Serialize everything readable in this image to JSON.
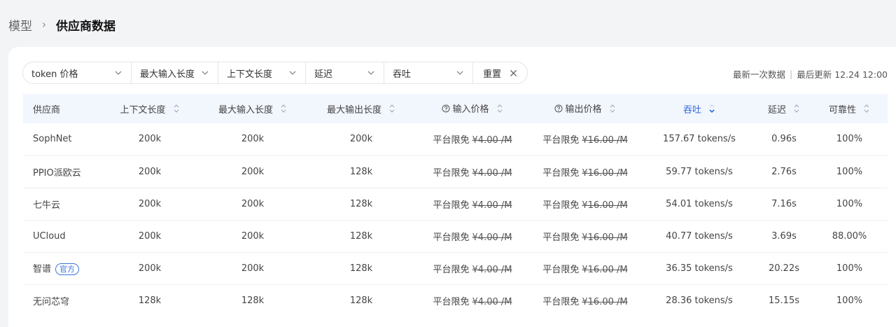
{
  "breadcrumb": {
    "parent": "模型",
    "current": "供应商数据"
  },
  "filters": [
    {
      "label": "token 价格"
    },
    {
      "label": "最大输入长度"
    },
    {
      "label": "上下文长度"
    },
    {
      "label": "延迟"
    },
    {
      "label": "吞吐"
    }
  ],
  "reset_label": "重置",
  "updated": {
    "latest": "最新一次数据",
    "last_update": "最后更新 12.24 12:00"
  },
  "columns": [
    "供应商",
    "上下文长度",
    "最大输入长度",
    "最大输出长度",
    "输入价格",
    "输出价格",
    "吞吐",
    "延迟",
    "可靠性"
  ],
  "free_label": "平台限免",
  "rows": [
    {
      "provider": "SophNet",
      "badge": "",
      "context": "200k",
      "max_in": "200k",
      "max_out": "200k",
      "in_price": "¥4.00 /M",
      "out_price": "¥16.00 /M",
      "throughput": "157.67 tokens/s",
      "latency": "0.96s",
      "reliability": "100%"
    },
    {
      "provider": "PPIO派欧云",
      "badge": "",
      "context": "200k",
      "max_in": "200k",
      "max_out": "128k",
      "in_price": "¥4.00 /M",
      "out_price": "¥16.00 /M",
      "throughput": "59.77 tokens/s",
      "latency": "2.76s",
      "reliability": "100%"
    },
    {
      "provider": "七牛云",
      "badge": "",
      "context": "200k",
      "max_in": "200k",
      "max_out": "128k",
      "in_price": "¥4.00 /M",
      "out_price": "¥16.00 /M",
      "throughput": "54.01 tokens/s",
      "latency": "7.16s",
      "reliability": "100%"
    },
    {
      "provider": "UCloud",
      "badge": "",
      "context": "200k",
      "max_in": "200k",
      "max_out": "128k",
      "in_price": "¥4.00 /M",
      "out_price": "¥16.00 /M",
      "throughput": "40.77 tokens/s",
      "latency": "3.69s",
      "reliability": "88.00%"
    },
    {
      "provider": "智谱",
      "badge": "官方",
      "context": "200k",
      "max_in": "200k",
      "max_out": "128k",
      "in_price": "¥4.00 /M",
      "out_price": "¥16.00 /M",
      "throughput": "36.35 tokens/s",
      "latency": "20.22s",
      "reliability": "100%"
    },
    {
      "provider": "无问芯穹",
      "badge": "",
      "context": "128k",
      "max_in": "128k",
      "max_out": "128k",
      "in_price": "¥4.00 /M",
      "out_price": "¥16.00 /M",
      "throughput": "28.36 tokens/s",
      "latency": "15.15s",
      "reliability": "100%"
    }
  ],
  "colors": {
    "accent": "#2f6bdb",
    "header_bg": "#f2f6fd"
  }
}
